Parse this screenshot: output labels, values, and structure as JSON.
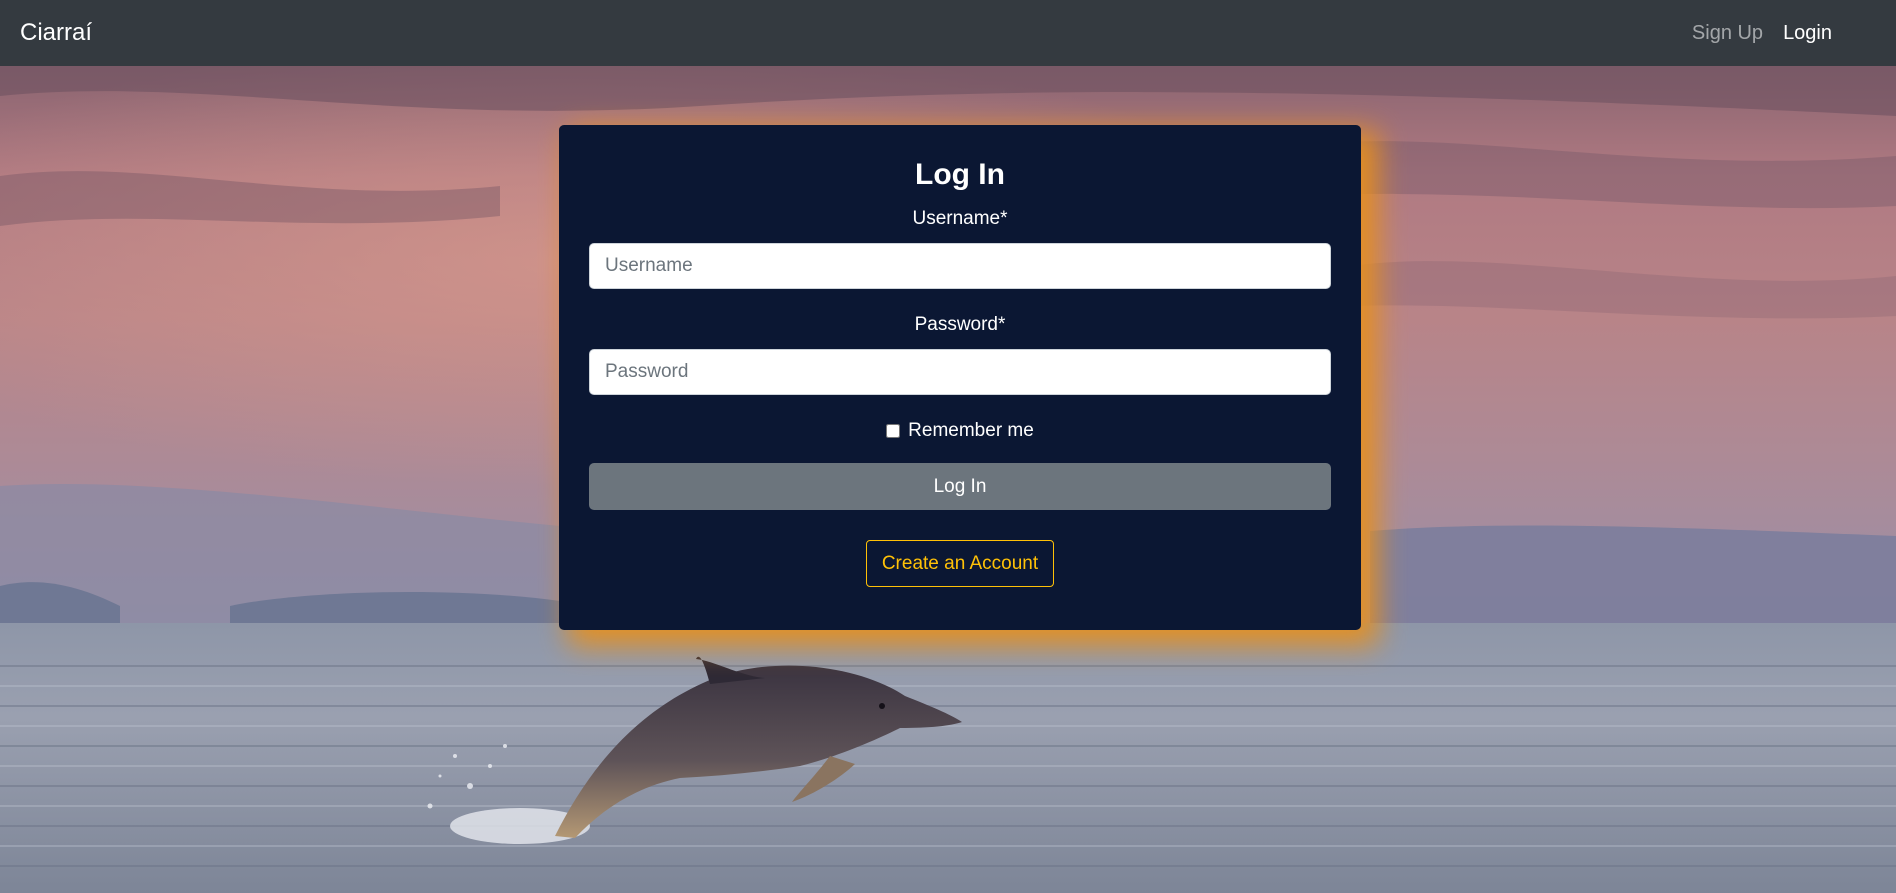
{
  "navbar": {
    "brand": "Ciarraí",
    "links": {
      "signup": "Sign Up",
      "login": "Login"
    }
  },
  "form": {
    "title": "Log In",
    "username": {
      "label": "Username*",
      "placeholder": "Username",
      "value": ""
    },
    "password": {
      "label": "Password*",
      "placeholder": "Password",
      "value": ""
    },
    "remember": {
      "label": "Remember me",
      "checked": false
    },
    "submit_label": "Log In",
    "create_account_label": "Create an Account"
  },
  "colors": {
    "navbar_bg": "#343a40",
    "card_bg": "#0b1733",
    "card_glow": "#e8901c",
    "submit_bg": "#6c757d",
    "accent": "#ffc107"
  },
  "background": {
    "subject": "dolphin-leaping-over-sea-at-dusk"
  }
}
